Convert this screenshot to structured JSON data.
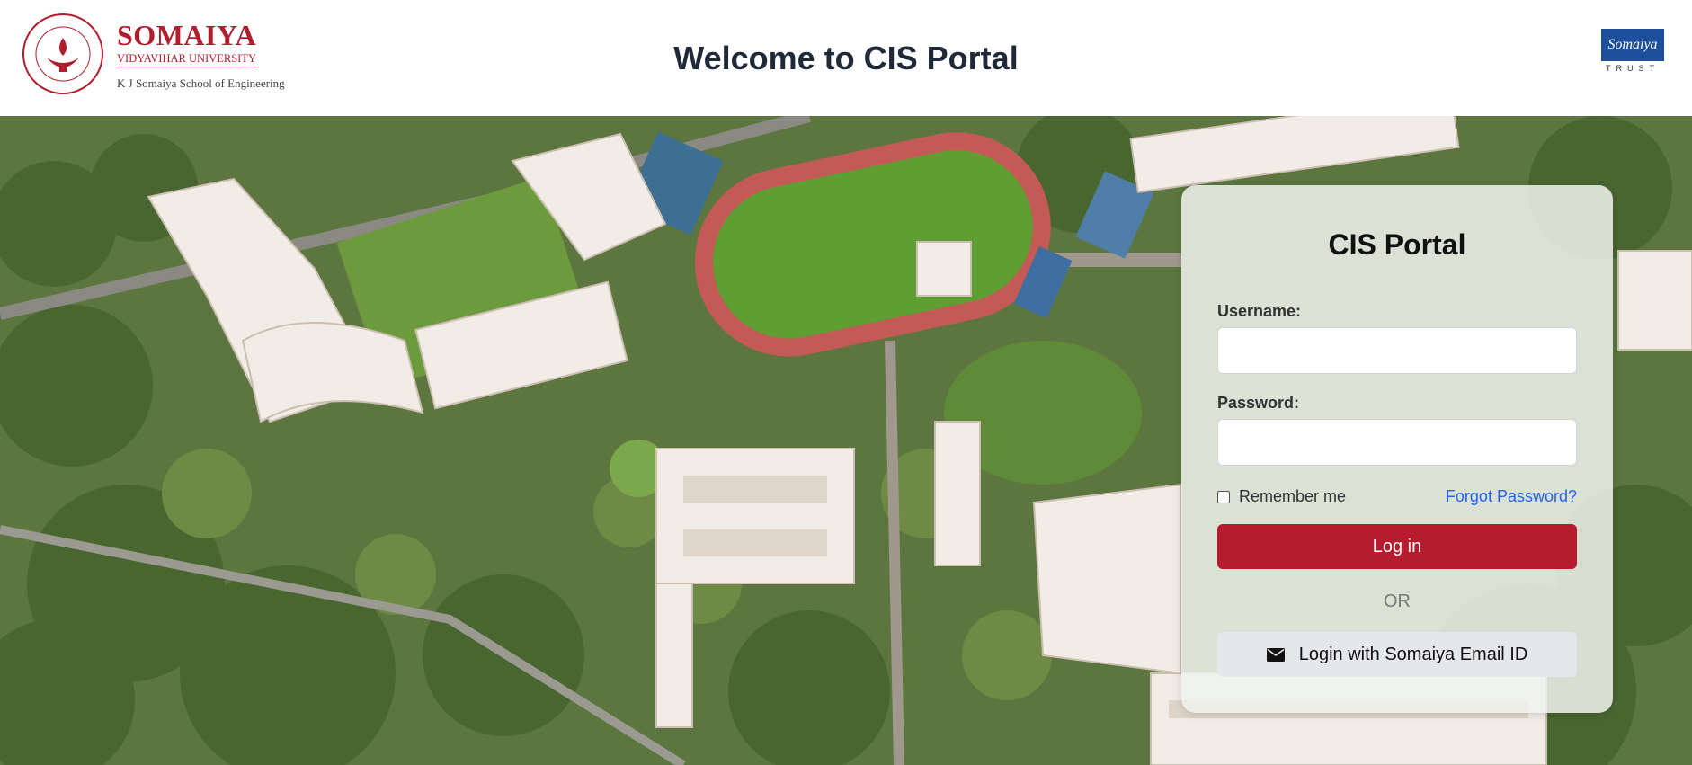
{
  "header": {
    "brand_name": "SOMAIYA",
    "brand_subtitle": "VIDYAVIHAR UNIVERSITY",
    "school_name": "K J Somaiya School of Engineering",
    "page_title": "Welcome to CIS Portal",
    "trust_logo_text": "Somaiya",
    "trust_caption": "TRUST"
  },
  "login": {
    "title": "CIS Portal",
    "username_label": "Username:",
    "username_value": "",
    "password_label": "Password:",
    "password_value": "",
    "remember_label": "Remember me",
    "forgot_label": "Forgot Password?",
    "login_button": "Log in",
    "or_text": "OR",
    "email_login_button": "Login with Somaiya Email ID"
  },
  "colors": {
    "brand_red": "#b01e2e",
    "login_button": "#b71c2e",
    "link_blue": "#2563eb",
    "trust_blue": "#1e4f9c"
  },
  "icons": {
    "email_button_icon": "envelope-icon"
  }
}
